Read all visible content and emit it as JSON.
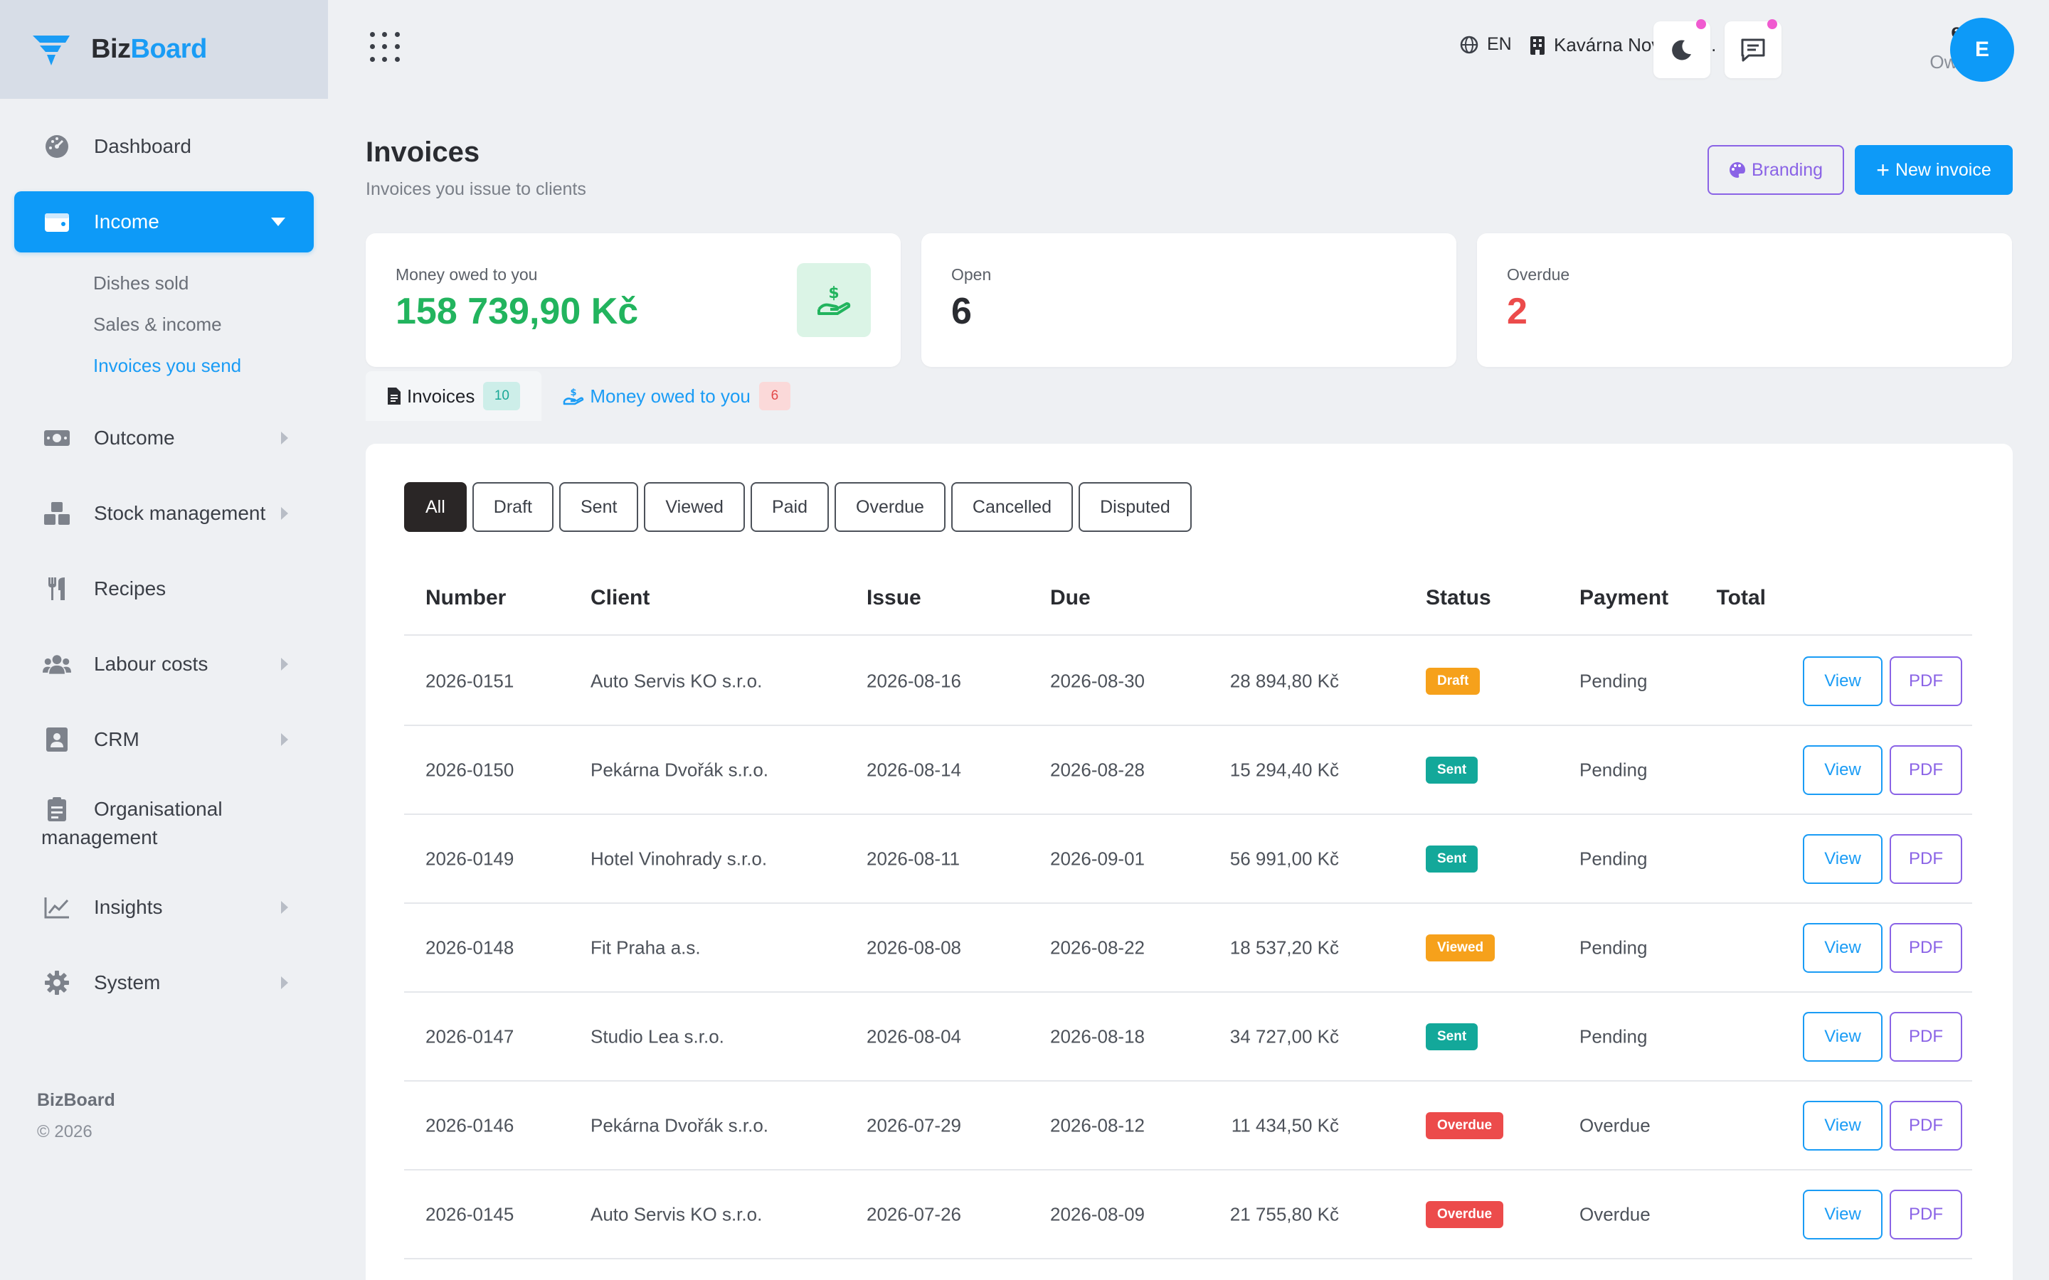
{
  "brand": {
    "part1": "Biz",
    "part2": "Board"
  },
  "sidebar": {
    "items": [
      {
        "label": "Dashboard"
      },
      {
        "label": "Income"
      },
      {
        "label": "Outcome"
      },
      {
        "label": "Stock management"
      },
      {
        "label": "Recipes"
      },
      {
        "label": "Labour costs"
      },
      {
        "label": "CRM"
      },
      {
        "label": "Organisational management"
      },
      {
        "label": "Insights"
      },
      {
        "label": "System"
      }
    ],
    "income_sub": [
      "Dishes sold",
      "Sales & income",
      "Invoices you send"
    ],
    "footer_brand": "BizBoard",
    "footer_copy": "© 2026"
  },
  "topbar": {
    "lang": "EN",
    "company": "Kavárna Nová s.r.o.",
    "user_name": "eva",
    "user_role": "Owner",
    "avatar_initial": "E"
  },
  "page": {
    "title": "Invoices",
    "subtitle": "Invoices you issue to clients",
    "branding_label": "Branding",
    "new_invoice_label": "New invoice"
  },
  "stats": {
    "owed": {
      "label": "Money owed to you",
      "value": "158 739,90 Kč"
    },
    "open": {
      "label": "Open",
      "value": "6"
    },
    "overdue": {
      "label": "Overdue",
      "value": "2"
    }
  },
  "tabs": {
    "invoices": {
      "label": "Invoices",
      "count": "10"
    },
    "owed": {
      "label": "Money owed to you",
      "count": "6"
    }
  },
  "filters": [
    "All",
    "Draft",
    "Sent",
    "Viewed",
    "Paid",
    "Overdue",
    "Cancelled",
    "Disputed"
  ],
  "table": {
    "headers": {
      "number": "Number",
      "client": "Client",
      "issue": "Issue",
      "due": "Due",
      "total": "Total",
      "status": "Status",
      "payment": "Payment"
    },
    "view_label": "View",
    "pdf_label": "PDF",
    "rows": [
      {
        "number": "2026-0151",
        "client": "Auto Servis KO s.r.o.",
        "issue": "2026-08-16",
        "due": "2026-08-30",
        "total": "28 894,80 Kč",
        "status": "Draft",
        "payment": "Pending"
      },
      {
        "number": "2026-0150",
        "client": "Pekárna Dvořák s.r.o.",
        "issue": "2026-08-14",
        "due": "2026-08-28",
        "total": "15 294,40 Kč",
        "status": "Sent",
        "payment": "Pending"
      },
      {
        "number": "2026-0149",
        "client": "Hotel Vinohrady s.r.o.",
        "issue": "2026-08-11",
        "due": "2026-09-01",
        "total": "56 991,00 Kč",
        "status": "Sent",
        "payment": "Pending"
      },
      {
        "number": "2026-0148",
        "client": "Fit Praha a.s.",
        "issue": "2026-08-08",
        "due": "2026-08-22",
        "total": "18 537,20 Kč",
        "status": "Viewed",
        "payment": "Pending"
      },
      {
        "number": "2026-0147",
        "client": "Studio Lea s.r.o.",
        "issue": "2026-08-04",
        "due": "2026-08-18",
        "total": "34 727,00 Kč",
        "status": "Sent",
        "payment": "Pending"
      },
      {
        "number": "2026-0146",
        "client": "Pekárna Dvořák s.r.o.",
        "issue": "2026-07-29",
        "due": "2026-08-12",
        "total": "11 434,50 Kč",
        "status": "Overdue",
        "payment": "Overdue"
      },
      {
        "number": "2026-0145",
        "client": "Auto Servis KO s.r.o.",
        "issue": "2026-07-26",
        "due": "2026-08-09",
        "total": "21 755,80 Kč",
        "status": "Overdue",
        "payment": "Overdue"
      }
    ]
  },
  "colors": {
    "accent": "#0d9af8",
    "purple": "#8a63e6",
    "green": "#22b45e",
    "red": "#ec4b4b",
    "status_draft": "#f6a11b",
    "status_sent": "#13a89a",
    "status_viewed": "#f6a11b",
    "status_overdue": "#ec4b4b"
  }
}
